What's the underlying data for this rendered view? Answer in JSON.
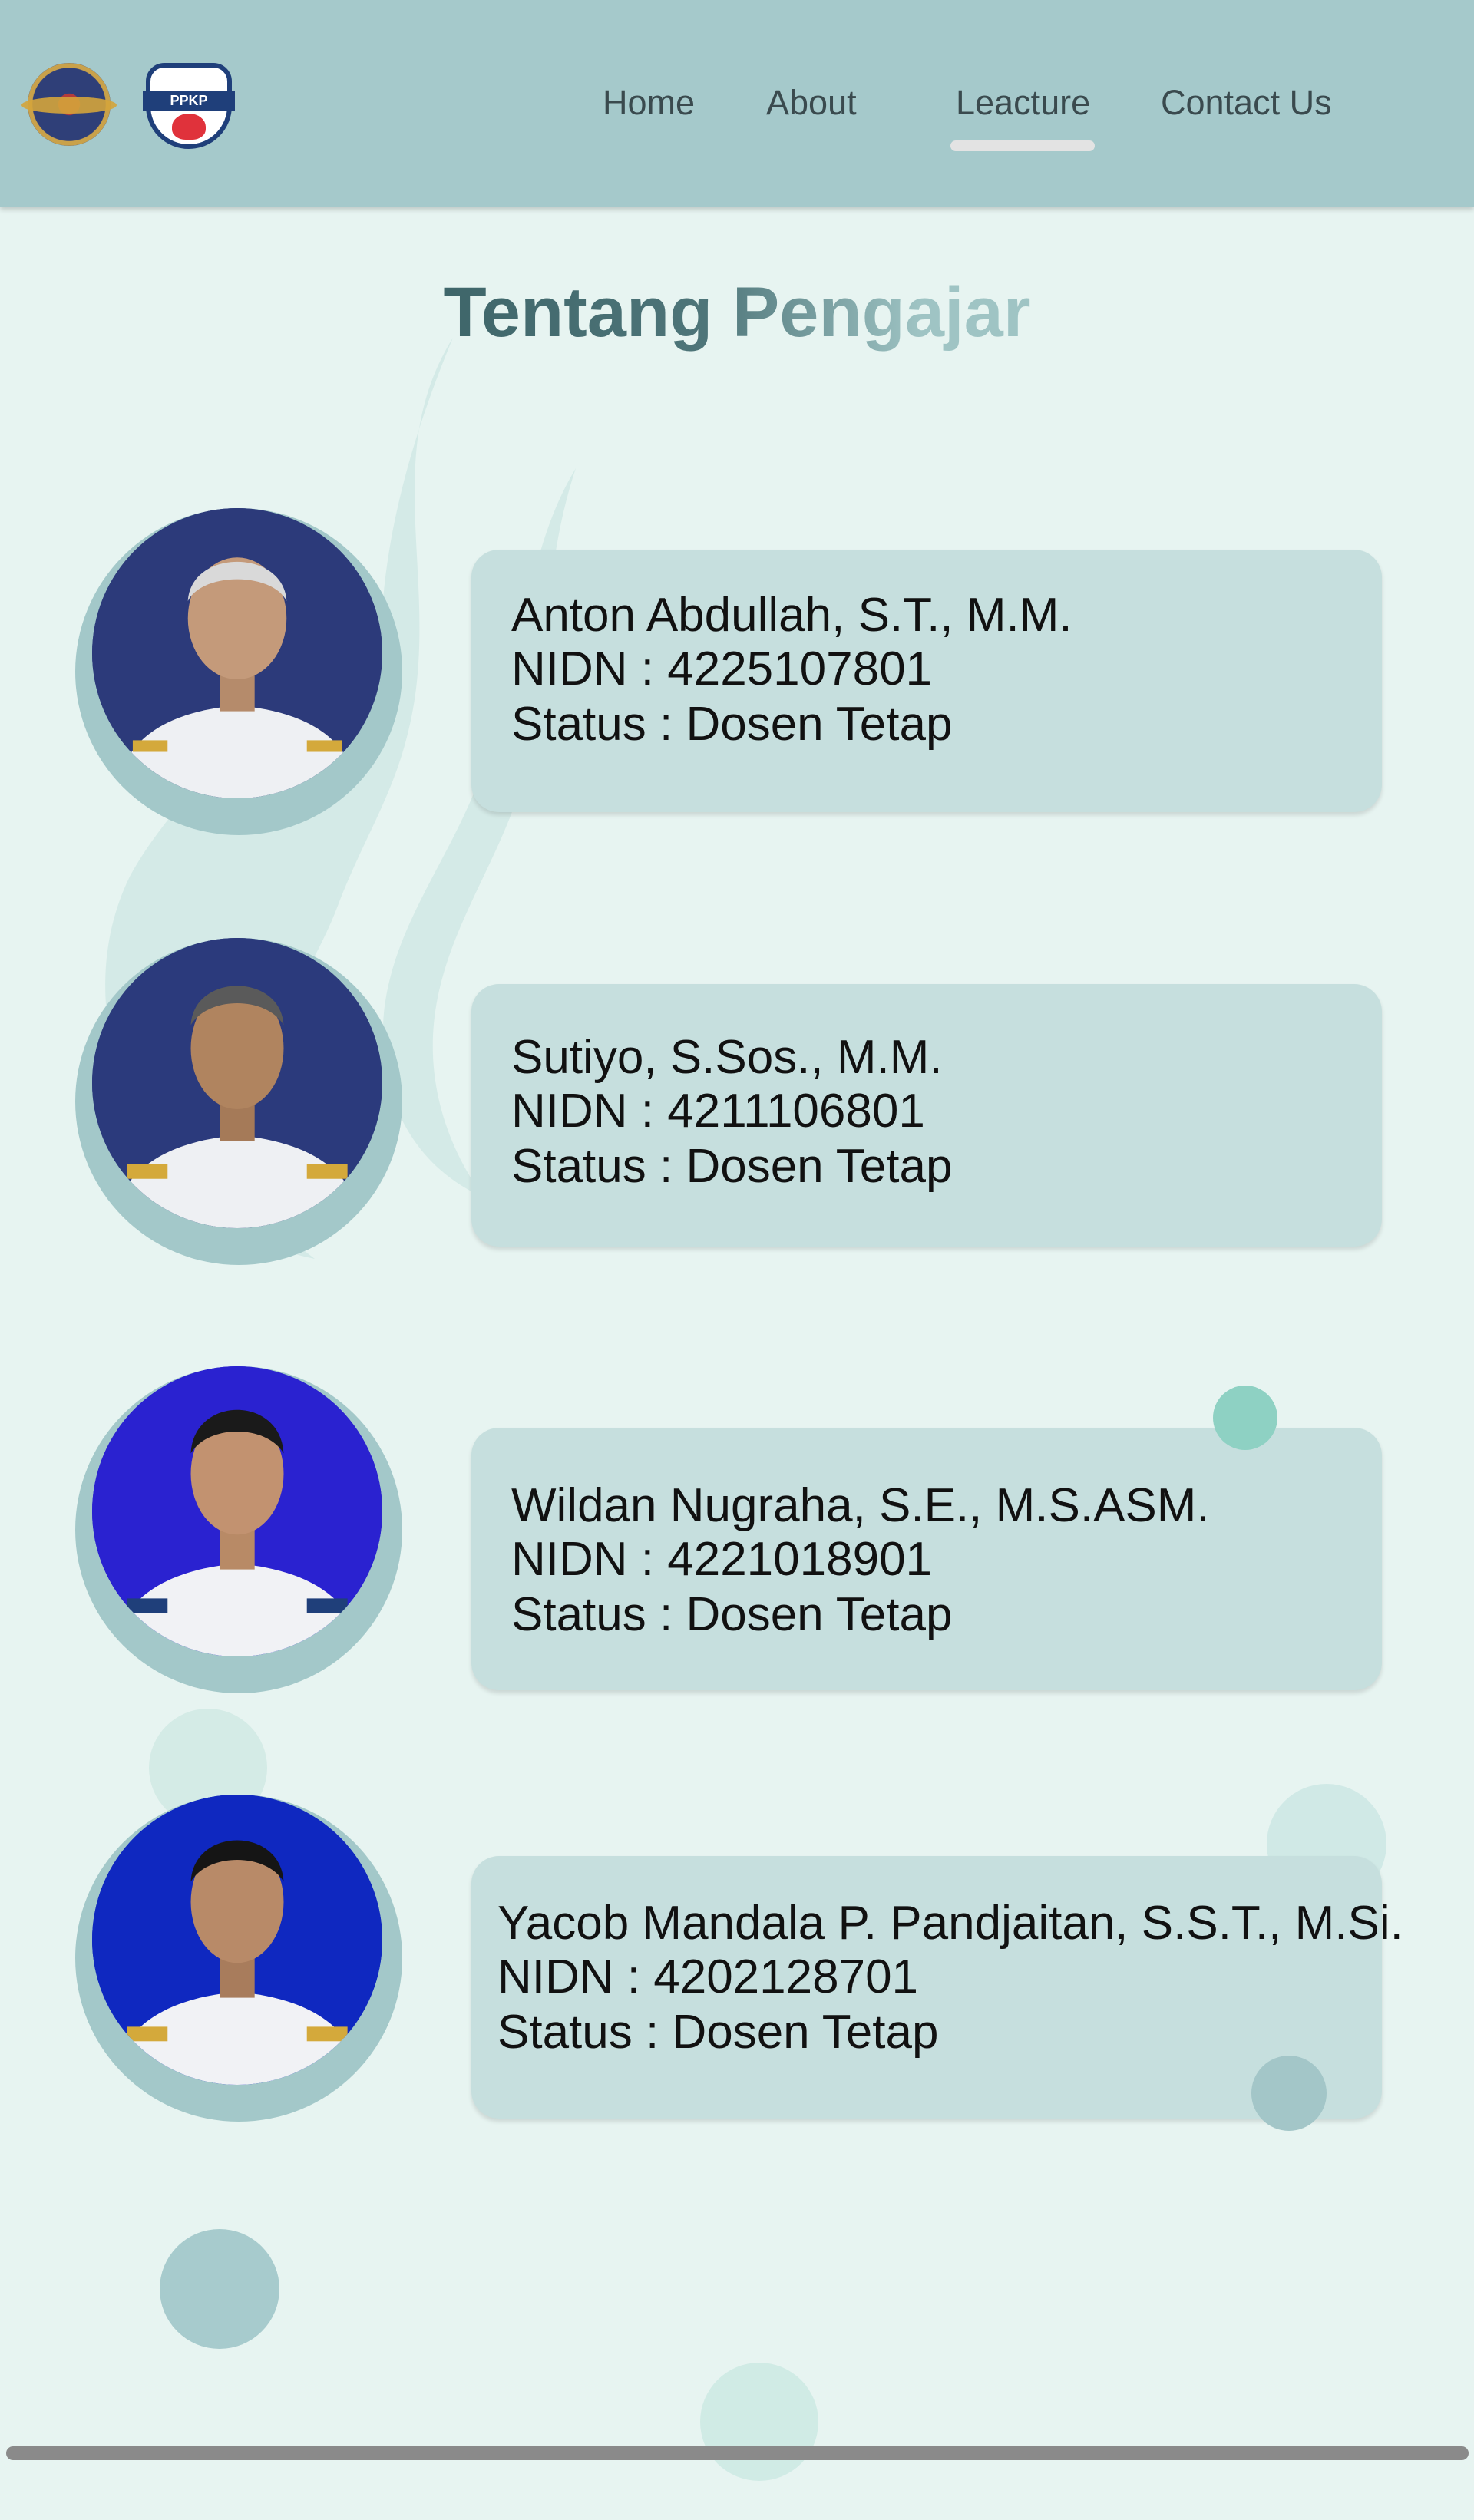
{
  "header": {
    "logos": [
      "institution-emblem-logo",
      "ppkp-logo"
    ],
    "ppkp_logo_text": "PPKP",
    "nav": [
      {
        "label": "Home"
      },
      {
        "label": "About"
      },
      {
        "label": "Leacture",
        "active": true
      },
      {
        "label": "Contact Us"
      }
    ]
  },
  "page": {
    "title": "Tentang Pengajar"
  },
  "lecturers": [
    {
      "name": "Anton Abdullah, S.T., M.M.",
      "nidn": "NIDN : 4225107801",
      "status": "Status :  Dosen Tetap",
      "photo_bg": "#2c3a7a"
    },
    {
      "name": "Sutiyo, S.Sos., M.M.",
      "nidn": "NIDN : 4211106801",
      "status": "Status : Dosen Tetap",
      "photo_bg": "#2b3a7c"
    },
    {
      "name": "Wildan Nugraha, S.E., M.S.ASM.",
      "nidn": "NIDN : 4221018901",
      "status": "Status : Dosen Tetap",
      "photo_bg": "#2a22d0"
    },
    {
      "name": "Yacob Mandala P. Pandjaitan, S.S.T., M.Si.",
      "nidn": "NIDN : 4202128701",
      "status": "Status : Dosen Tetap",
      "photo_bg": "#0f28c0"
    }
  ],
  "colors": {
    "background": "#e7f4f1",
    "header": "#a5c9cb",
    "card": "#c6dfde",
    "ring": "#a3c8c9",
    "title_dark": "#3e6569",
    "title_light": "#9fc4c4"
  }
}
